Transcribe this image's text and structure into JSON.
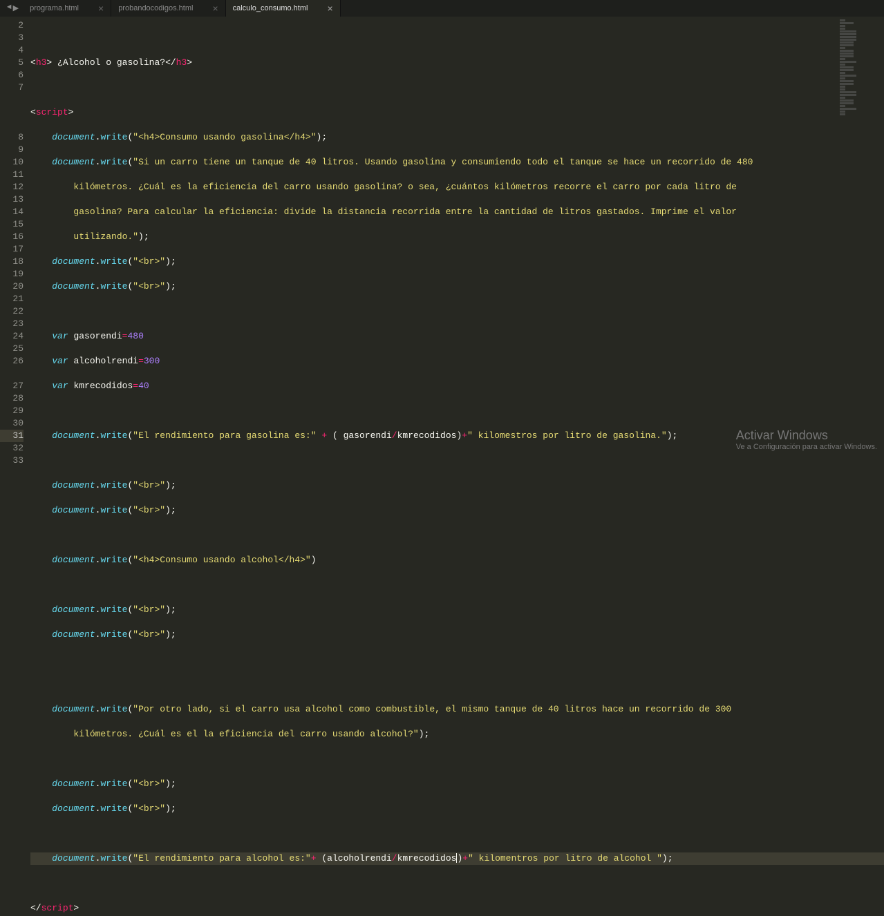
{
  "tabs": [
    {
      "label": "programa.html",
      "active": false
    },
    {
      "label": "probandocodigos.html",
      "active": false
    },
    {
      "label": "calculo_consumo.html",
      "active": true
    }
  ],
  "lines": {
    "l2": "2",
    "l3": {
      "n": "3",
      "txt1": " ¿Alcohol o gasolina?"
    },
    "l4": "4",
    "l5": "5",
    "l6": {
      "n": "6",
      "str": "\"<h4>Consumo usando gasolina</h4>\""
    },
    "l7": {
      "n": "7",
      "str": "\"Si un carro tiene un tanque de 40 litros. Usando gasolina y consumiendo todo el tanque se hace un recorrido de 480 "
    },
    "l7b": "kilómetros. ¿Cuál es la eficiencia del carro usando gasolina? o sea, ¿cuántos kilómetros recorre el carro por cada litro de ",
    "l7c": "gasolina? Para calcular la eficiencia: divide la distancia recorrida entre la cantidad de litros gastados. Imprime el valor ",
    "l7d": "utilizando.\"",
    "l8": {
      "n": "8",
      "str": "\"<br>\""
    },
    "l9": {
      "n": "9",
      "str": "\"<br>\""
    },
    "l10": "10",
    "l11": {
      "n": "11",
      "var": "gasorendi",
      "num": "480"
    },
    "l12": {
      "n": "12",
      "var": "alcoholrendi",
      "num": "300"
    },
    "l13": {
      "n": "13",
      "var": "kmrecodidos",
      "num": "40"
    },
    "l14": "14",
    "l15": {
      "n": "15",
      "s1": "\"El rendimiento para gasolina es:\" ",
      "v1": "gasorendi",
      "v2": "kmrecodidos",
      "s2": "\" kilomestros por litro de gasolina.\""
    },
    "l16": "16",
    "l17": {
      "n": "17",
      "str": "\"<br>\""
    },
    "l18": {
      "n": "18",
      "str": "\"<br>\""
    },
    "l19": "19",
    "l20": {
      "n": "20",
      "str": "\"<h4>Consumo usando alcohol</h4>\""
    },
    "l21": "21",
    "l22": {
      "n": "22",
      "str": "\"<br>\""
    },
    "l23": {
      "n": "23",
      "str": "\"<br>\""
    },
    "l24": "24",
    "l25": "25",
    "l26": {
      "n": "26",
      "str": "\"Por otro lado, si el carro usa alcohol como combustible, el mismo tanque de 40 litros hace un recorrido de 300 "
    },
    "l26b": "kilómetros. ¿Cuál es el la eficiencia del carro usando alcohol?\"",
    "l27": "27",
    "l28": {
      "n": "28",
      "str": "\"<br>\""
    },
    "l29": {
      "n": "29",
      "str": "\"<br>\""
    },
    "l30": "30",
    "l31": {
      "n": "31",
      "s1": "\"El rendimiento para alcohol es:\"",
      "v1": "alcoholrendi",
      "v2": "kmrecodidos",
      "s2": "\" kilomentros por litro de alcohol \""
    },
    "l32": "32",
    "l33": "33"
  },
  "doc": "document",
  "write": "write",
  "varKw": "var",
  "scriptTag": "script",
  "h3": "h3",
  "watermark": {
    "title": "Activar Windows",
    "sub": "Ve a Configuración para activar Windows."
  }
}
